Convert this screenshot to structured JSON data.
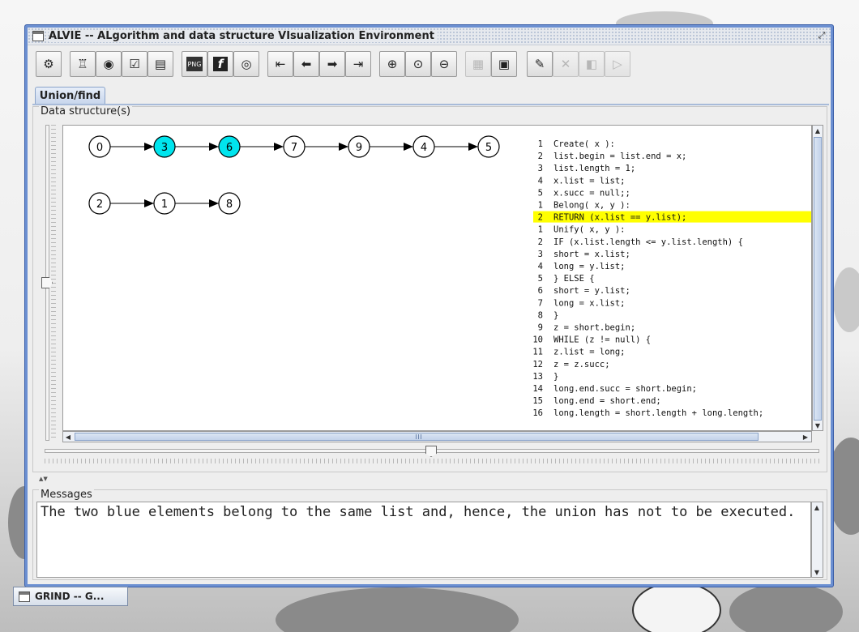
{
  "window": {
    "title": "ALVIE -- ALgorithm and data structure VIsualization Environment"
  },
  "toolbar": {
    "groups": [
      [
        "settings-icon"
      ],
      [
        "open-algorithm-icon",
        "view-icon",
        "checklist-icon",
        "document-icon"
      ],
      [
        "png-export-icon",
        "flash-export-icon",
        "movie-export-icon"
      ],
      [
        "first-step-icon",
        "previous-step-icon",
        "next-step-icon",
        "last-step-icon"
      ],
      [
        "zoom-in-icon",
        "zoom-reset-icon",
        "zoom-out-icon"
      ],
      [
        "disabled-icon",
        "record-icon"
      ],
      [
        "edit-icon",
        "close-icon",
        "prev-icon",
        "next-icon"
      ]
    ]
  },
  "tabs": [
    {
      "label": "Union/find"
    }
  ],
  "panels": {
    "data_structures_label": "Data structure(s)",
    "messages_label": "Messages"
  },
  "lists": [
    {
      "nodes": [
        "0",
        "3",
        "6",
        "7",
        "9",
        "4",
        "5"
      ],
      "highlighted": [
        "3",
        "6"
      ]
    },
    {
      "nodes": [
        "2",
        "1",
        "8"
      ],
      "highlighted": []
    }
  ],
  "highlight_color": "#00e5ee",
  "code": [
    {
      "num": "1",
      "text": "Create( x ):",
      "highlight": false
    },
    {
      "num": "2",
      "text": "  list.begin = list.end = x;",
      "highlight": false
    },
    {
      "num": "3",
      "text": "  list.length = 1;",
      "highlight": false
    },
    {
      "num": "4",
      "text": "  x.list = list;",
      "highlight": false
    },
    {
      "num": "5",
      "text": "  x.succ = null;;",
      "highlight": false
    },
    {
      "num": "1",
      "text": "Belong( x, y ):",
      "highlight": false
    },
    {
      "num": "2",
      "text": "  RETURN (x.list == y.list);",
      "highlight": true
    },
    {
      "num": "1",
      "text": "Unify( x, y ):",
      "highlight": false
    },
    {
      "num": "2",
      "text": "  IF (x.list.length <= y.list.length) {",
      "highlight": false
    },
    {
      "num": "3",
      "text": "    short = x.list;",
      "highlight": false
    },
    {
      "num": "4",
      "text": "    long = y.list;",
      "highlight": false
    },
    {
      "num": "5",
      "text": "  } ELSE {",
      "highlight": false
    },
    {
      "num": "6",
      "text": "    short = y.list;",
      "highlight": false
    },
    {
      "num": "7",
      "text": "    long = x.list;",
      "highlight": false
    },
    {
      "num": "8",
      "text": "  }",
      "highlight": false
    },
    {
      "num": "9",
      "text": "  z = short.begin;",
      "highlight": false
    },
    {
      "num": "10",
      "text": "  WHILE (z != null) {",
      "highlight": false
    },
    {
      "num": "11",
      "text": "    z.list = long;",
      "highlight": false
    },
    {
      "num": "12",
      "text": "    z = z.succ;",
      "highlight": false
    },
    {
      "num": "13",
      "text": "  }",
      "highlight": false
    },
    {
      "num": "14",
      "text": "  long.end.succ = short.begin;",
      "highlight": false
    },
    {
      "num": "15",
      "text": "  long.end = short.end;",
      "highlight": false
    },
    {
      "num": "16",
      "text": "  long.length = short.length + long.length;",
      "highlight": false
    }
  ],
  "code_highlight_color": "#ffff00",
  "message": "The two blue elements belong to the same list and, hence, the union has not to be executed.",
  "taskbar": {
    "label": "GRIND -- G..."
  }
}
